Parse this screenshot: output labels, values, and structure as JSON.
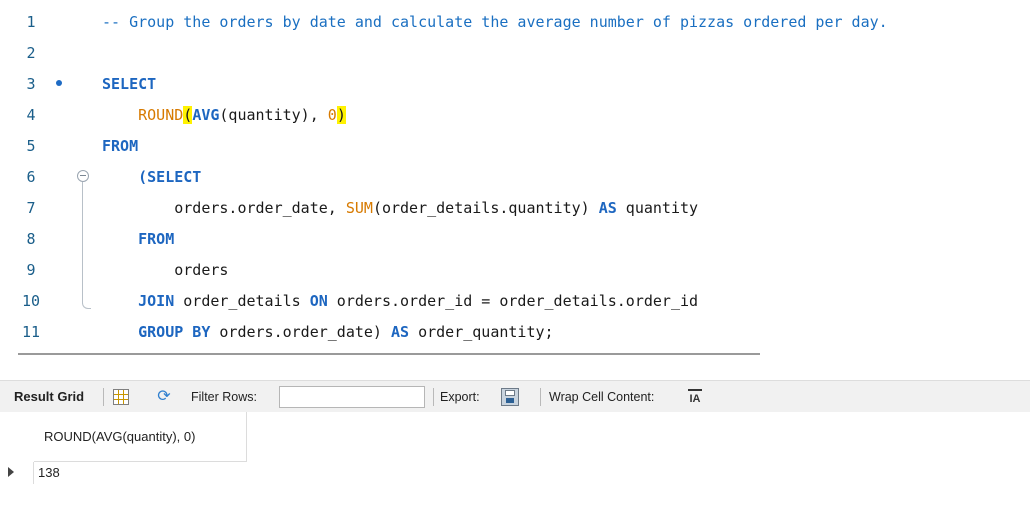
{
  "editor": {
    "lines": [
      {
        "num": "1",
        "segments": [
          {
            "t": "-- Group the orders by date and calculate the average number of pizzas ordered per day.",
            "c": "comment"
          }
        ]
      },
      {
        "num": "2",
        "segments": []
      },
      {
        "num": "3",
        "breakpoint": true,
        "segments": [
          {
            "t": "SELECT",
            "c": "kw"
          }
        ]
      },
      {
        "num": "4",
        "segments": [
          {
            "t": "    "
          },
          {
            "t": "ROUND",
            "c": "fn"
          },
          {
            "t": "(",
            "c": "hl"
          },
          {
            "t": "AVG",
            "c": "kw"
          },
          {
            "t": "(quantity), "
          },
          {
            "t": "0",
            "c": "num"
          },
          {
            "t": ")",
            "c": "hl"
          }
        ]
      },
      {
        "num": "5",
        "segments": [
          {
            "t": "FROM",
            "c": "kw"
          }
        ]
      },
      {
        "num": "6",
        "segments": [
          {
            "t": "    "
          },
          {
            "t": "(SELECT",
            "c": "kw"
          }
        ]
      },
      {
        "num": "7",
        "segments": [
          {
            "t": "        orders.order_date, "
          },
          {
            "t": "SUM",
            "c": "fn"
          },
          {
            "t": "(order_details.quantity) "
          },
          {
            "t": "AS",
            "c": "kw"
          },
          {
            "t": " quantity"
          }
        ]
      },
      {
        "num": "8",
        "segments": [
          {
            "t": "    "
          },
          {
            "t": "FROM",
            "c": "kw"
          }
        ]
      },
      {
        "num": "9",
        "segments": [
          {
            "t": "        orders"
          }
        ]
      },
      {
        "num": "10",
        "segments": [
          {
            "t": "    "
          },
          {
            "t": "JOIN",
            "c": "kw"
          },
          {
            "t": " order_details "
          },
          {
            "t": "ON",
            "c": "kw"
          },
          {
            "t": " orders.order_id = order_details.order_id"
          }
        ]
      },
      {
        "num": "11",
        "segments": [
          {
            "t": "    "
          },
          {
            "t": "GROUP BY",
            "c": "kw"
          },
          {
            "t": " orders.order_date) "
          },
          {
            "t": "AS",
            "c": "kw"
          },
          {
            "t": " order_quantity;"
          }
        ]
      }
    ]
  },
  "toolbar": {
    "result_grid_label": "Result Grid",
    "filter_label": "Filter Rows:",
    "filter_value": "",
    "export_label": "Export:",
    "wrap_label": "Wrap Cell Content:",
    "wrap_icon_text": "IA"
  },
  "result": {
    "columns": [
      "ROUND(AVG(quantity), 0)"
    ],
    "rows": [
      [
        "138"
      ]
    ]
  },
  "colors": {
    "keyword": "#1d66c0",
    "function": "#d77a00",
    "comment": "#1a6fc1",
    "line_number": "#1a5e8a",
    "bracket_highlight": "#fff200"
  }
}
